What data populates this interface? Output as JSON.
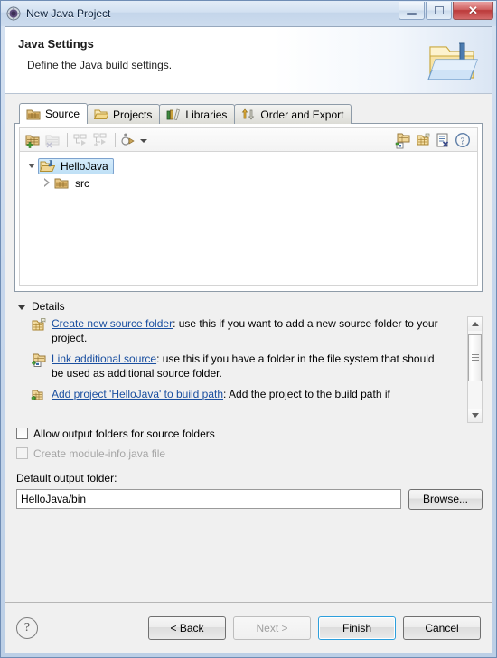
{
  "window": {
    "title": "New Java Project",
    "icon": "eclipse-wizard-icon",
    "caption_buttons": [
      {
        "name": "minimize",
        "glyph": "—"
      },
      {
        "name": "maximize",
        "glyph": "□"
      },
      {
        "name": "close",
        "glyph": "✕"
      }
    ]
  },
  "header": {
    "title": "Java Settings",
    "description": "Define the Java build settings.",
    "icon": "java-project-folder-icon"
  },
  "tabs": [
    {
      "label": "Source",
      "icon": "source-folder-icon",
      "active": true
    },
    {
      "label": "Projects",
      "icon": "open-folder-icon",
      "active": false
    },
    {
      "label": "Libraries",
      "icon": "library-books-icon",
      "active": false
    },
    {
      "label": "Order and Export",
      "icon": "order-export-icon",
      "active": false
    }
  ],
  "source_toolbar": {
    "left_buttons": [
      {
        "name": "add-folder-button",
        "icon": "add-source-folder-icon",
        "enabled": true
      },
      {
        "name": "remove-folder-button",
        "icon": "remove-source-folder-icon",
        "enabled": false
      },
      {
        "name": "collapse-all-button",
        "icon": "collapse-all-icon",
        "enabled": false
      },
      {
        "name": "expand-all-button",
        "icon": "expand-all-icon",
        "enabled": false
      },
      {
        "name": "configure-filters-button",
        "icon": "configure-filters-icon",
        "enabled": true
      },
      {
        "name": "toolbar-dropdown",
        "icon": "chevron-down-icon",
        "enabled": true
      }
    ],
    "right_buttons": [
      {
        "name": "link-source-button",
        "icon": "link-source-icon",
        "enabled": true
      },
      {
        "name": "create-folder-button",
        "icon": "create-new-folder-icon",
        "enabled": true
      },
      {
        "name": "remove-entry-button",
        "icon": "remove-entry-icon",
        "enabled": true
      },
      {
        "name": "help-button",
        "icon": "question-mark-icon",
        "enabled": true
      }
    ]
  },
  "tree": {
    "nodes": [
      {
        "label": "HelloJava",
        "icon": "java-project-icon",
        "expanded": true,
        "selected": true,
        "children": [
          {
            "label": "src",
            "icon": "source-folder-icon",
            "expanded": false,
            "selected": false
          }
        ]
      }
    ]
  },
  "details": {
    "title": "Details",
    "expanded": true,
    "items": [
      {
        "icon": "create-new-folder-icon",
        "link": "Create new source folder",
        "rest": ": use this if you want to add a new source folder to your project."
      },
      {
        "icon": "link-source-icon",
        "link": "Link additional source",
        "rest": ": use this if you have a folder in the file system that should be used as additional source folder."
      },
      {
        "icon": "java-project-icon",
        "link": "Add project 'HelloJava' to build path",
        "rest": ": Add the project to the build path if"
      }
    ],
    "scrollbar": {
      "up_glyph": "▲",
      "down_glyph": "▼"
    }
  },
  "options": [
    {
      "label": "Allow output folders for source folders",
      "checked": false,
      "enabled": true
    },
    {
      "label": "Create module-info.java file",
      "checked": false,
      "enabled": false
    }
  ],
  "output_folder": {
    "label": "Default output folder:",
    "value": "HelloJava/bin",
    "placeholder": "",
    "browse_label": "Browse..."
  },
  "buttonbar": {
    "help_glyph": "?",
    "buttons": [
      {
        "label": "< Back",
        "enabled": true,
        "default": false
      },
      {
        "label": "Next >",
        "enabled": false,
        "default": false
      },
      {
        "label": "Finish",
        "enabled": true,
        "default": true
      },
      {
        "label": "Cancel",
        "enabled": true,
        "default": false
      }
    ]
  },
  "colors": {
    "accent": "#2d9fdc",
    "link": "#1a4fa0",
    "titlebar": "#cddcee",
    "dialog_bg": "#f0f0f0",
    "close_button": "#bb3a3a",
    "selection": "#bfe0f6"
  }
}
